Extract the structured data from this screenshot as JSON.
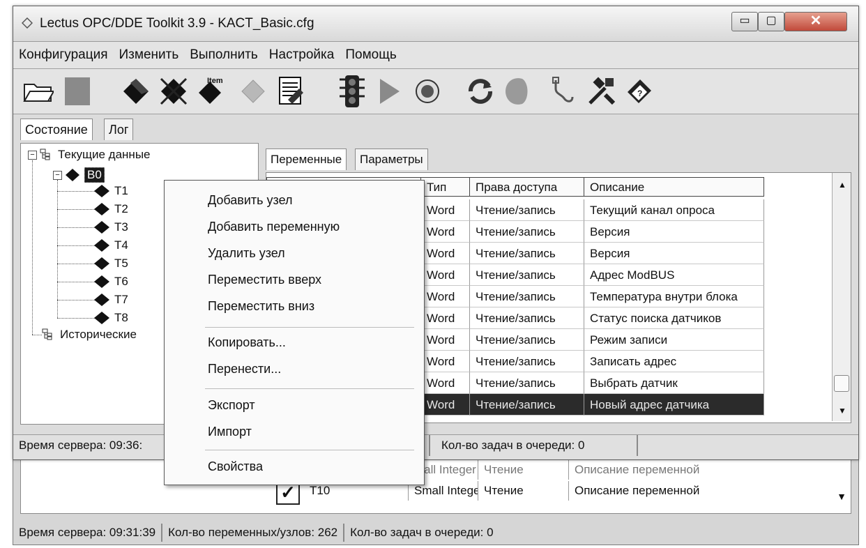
{
  "window": {
    "title": "Lectus OPC/DDE Toolkit 3.9 - KACT_Basic.cfg",
    "controls": {
      "minimize": "▭",
      "maximize": "▢",
      "close": "✕"
    }
  },
  "menu": [
    "Конфигурация",
    "Изменить",
    "Выполнить",
    "Настройка",
    "Помощь"
  ],
  "toolbar": {
    "icons": [
      "open-folder-icon",
      "save-icon",
      "add-node-icon",
      "delete-node-icon",
      "add-item-icon",
      "disabled-item-icon",
      "export-document-icon",
      "traffic-light-icon",
      "play-icon",
      "stop-icon",
      "refresh-icon",
      "disabled-cloud-icon",
      "connection-icon",
      "tools-icon",
      "help-book-icon"
    ],
    "item_icon_text": "Item"
  },
  "outer_tabs": [
    "Состояние",
    "Лог"
  ],
  "tree": {
    "root": "Текущие данные",
    "node": "B0",
    "children": [
      "T1",
      "T2",
      "T3",
      "T4",
      "T5",
      "T6",
      "T7",
      "T8"
    ],
    "history": "Исторические"
  },
  "inner_tabs": [
    "Переменные",
    "Параметры"
  ],
  "table": {
    "columns": [
      "",
      "Тип",
      "Права доступа",
      "Описание"
    ],
    "rows": [
      {
        "type": "Word",
        "access": "Чтение/запись",
        "desc": "Текущий канал опроса"
      },
      {
        "type": "Word",
        "access": "Чтение/запись",
        "desc": "Версия"
      },
      {
        "type": "Word",
        "access": "Чтение/запись",
        "desc": "Версия"
      },
      {
        "type": "Word",
        "access": "Чтение/запись",
        "desc": "Адрес ModBUS"
      },
      {
        "type": "Word",
        "access": "Чтение/запись",
        "desc": "Температура внутри блока"
      },
      {
        "type": "Word",
        "access": "Чтение/запись",
        "desc": "Статус поиска датчиков"
      },
      {
        "type": "Word",
        "access": "Чтение/запись",
        "desc": "Режим записи"
      },
      {
        "type": "Word",
        "access": "Чтение/запись",
        "desc": "Записать адрес"
      },
      {
        "type": "Word",
        "access": "Чтение/запись",
        "desc": "Выбрать датчик"
      },
      {
        "type": "Word",
        "access": "Чтение/запись",
        "desc": "Новый адрес датчика",
        "selected": true
      }
    ]
  },
  "status": {
    "server_time": "Время сервера: 09:36:",
    "tasks": "Кол-во задач в очереди: 0"
  },
  "context_menu": {
    "items": [
      "Добавить узел",
      "Добавить переменную",
      "Удалить узел",
      "Переместить вверх",
      "Переместить вниз",
      "Копировать...",
      "Перенести...",
      "Экспорт",
      "Импорт",
      "Свойства"
    ]
  },
  "background_window": {
    "header_row": {
      "type": "mall Integer",
      "access": "Чтение",
      "desc": "Описание переменной"
    },
    "row": {
      "name": "T10",
      "type": "Small Integer",
      "access": "Чтение",
      "desc": "Описание переменной"
    },
    "status": {
      "server_time": "Время сервера: 09:31:39",
      "vars": "Кол-во переменных/узлов: 262",
      "tasks": "Кол-во задач в очереди: 0"
    }
  }
}
